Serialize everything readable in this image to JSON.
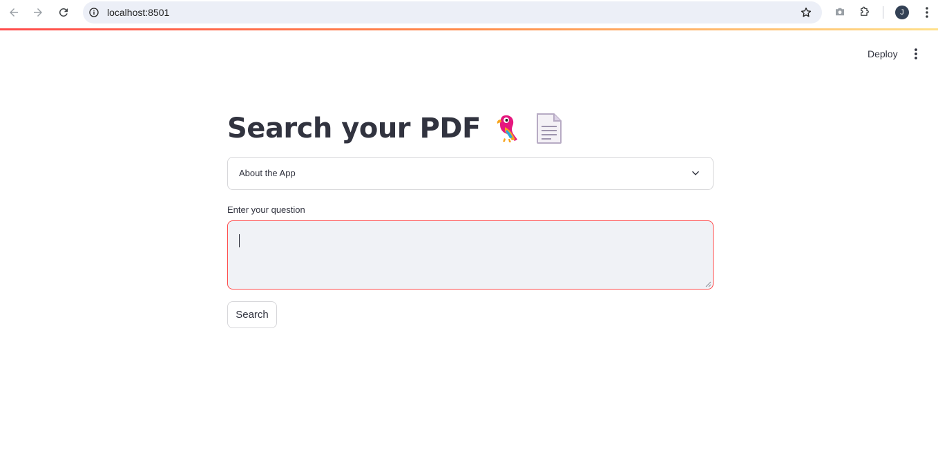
{
  "browser": {
    "url": "localhost:8501",
    "profile_initial": "J"
  },
  "header": {
    "deploy_label": "Deploy"
  },
  "main": {
    "title": "Search your PDF",
    "title_emojis": [
      "parrot-icon",
      "document-icon"
    ],
    "expander_label": "About the App",
    "question_label": "Enter your question",
    "question_value": "",
    "search_label": "Search"
  },
  "colors": {
    "accent": "#ff4b4b",
    "text": "#31333f",
    "input_bg": "#f0f2f6"
  }
}
